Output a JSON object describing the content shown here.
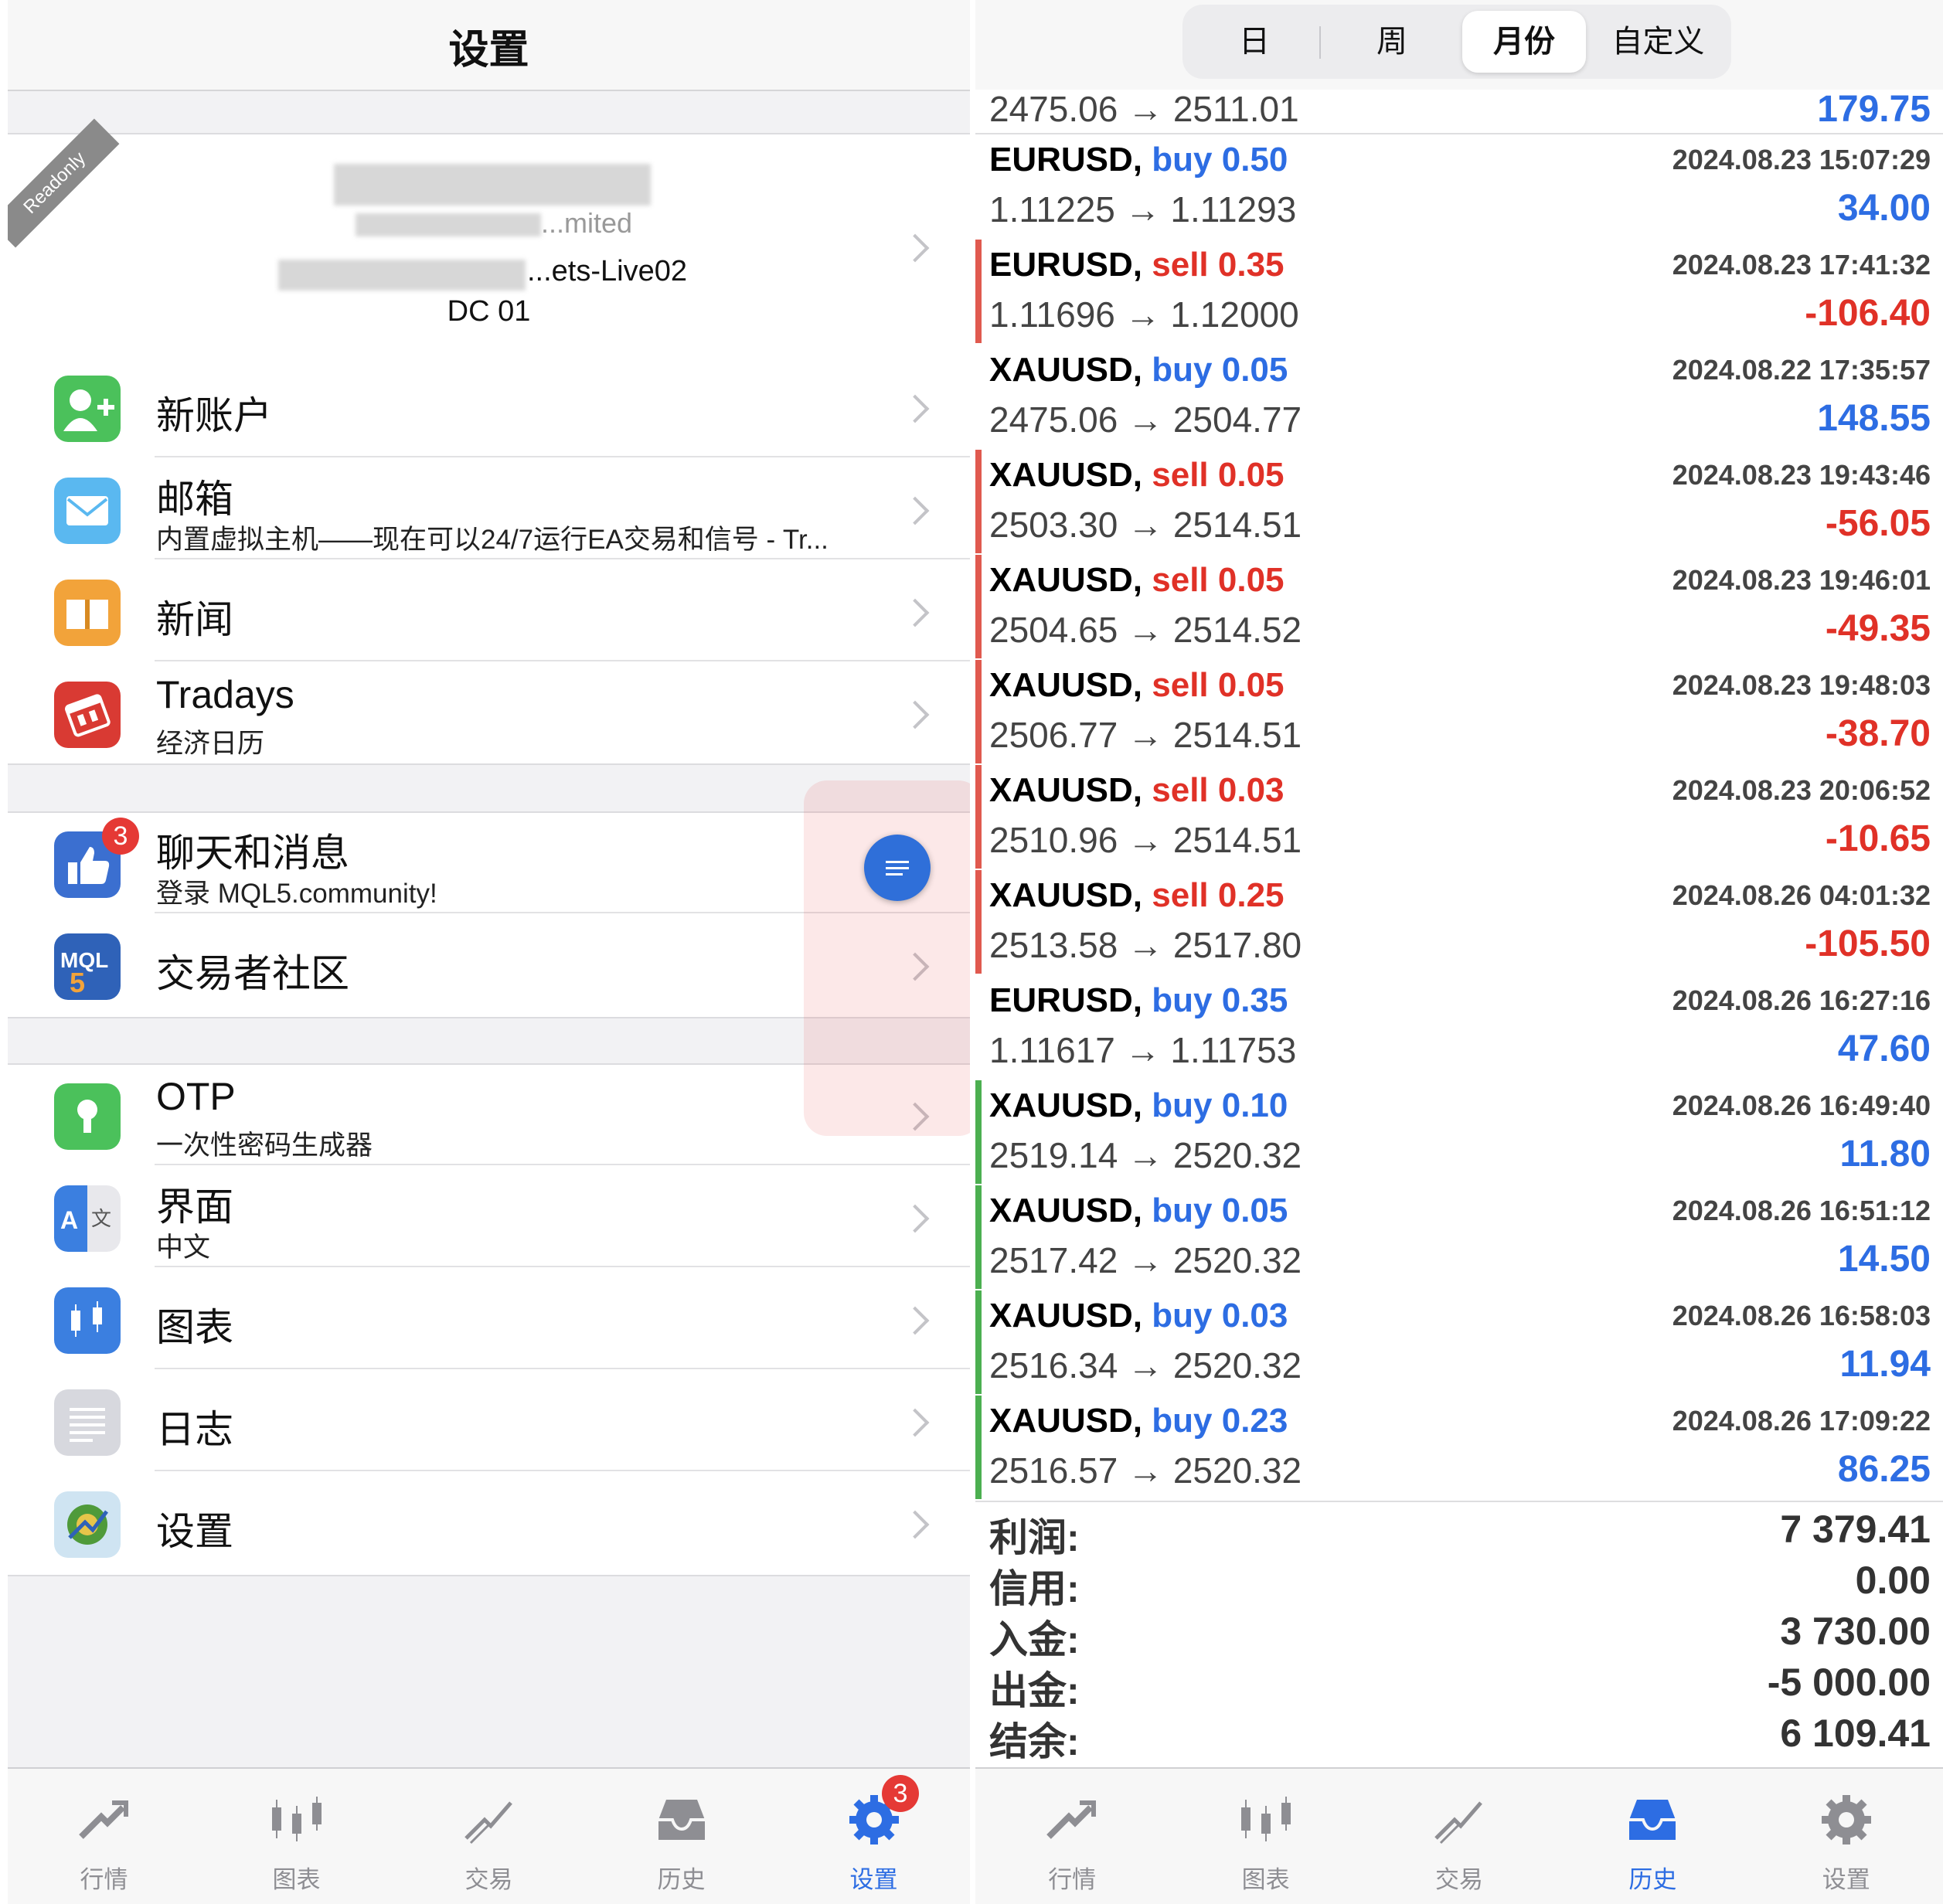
{
  "left": {
    "title": "设置",
    "account": {
      "readonly": "Readonly",
      "name_line": "...mited",
      "server": "...ets-Live02",
      "dc": "DC 01"
    },
    "items": [
      {
        "label": "新账户",
        "sub": "",
        "icon": "add-user-icon"
      },
      {
        "label": "邮箱",
        "sub": "内置虚拟主机——现在可以24/7运行EA交易和信号 - Tr...",
        "icon": "mail-icon"
      },
      {
        "label": "新闻",
        "sub": "",
        "icon": "book-icon"
      },
      {
        "label": "Tradays",
        "sub": "经济日历",
        "icon": "calendar-icon"
      },
      {
        "label": "聊天和消息",
        "sub": "登录 MQL5.community!",
        "icon": "chat-thumb-icon",
        "badge": "3"
      },
      {
        "label": "交易者社区",
        "sub": "",
        "icon": "mql5-icon"
      },
      {
        "label": "OTP",
        "sub": "一次性密码生成器",
        "icon": "lock-icon"
      },
      {
        "label": "界面",
        "sub": "中文",
        "icon": "translate-icon"
      },
      {
        "label": "图表",
        "sub": "",
        "icon": "candles-icon"
      },
      {
        "label": "日志",
        "sub": "",
        "icon": "journal-icon"
      },
      {
        "label": "设置",
        "sub": "",
        "icon": "metatrader-icon"
      }
    ],
    "tabs": [
      {
        "label": "行情",
        "icon": "quotes-icon"
      },
      {
        "label": "图表",
        "icon": "chart-icon"
      },
      {
        "label": "交易",
        "icon": "trade-icon"
      },
      {
        "label": "历史",
        "icon": "history-icon"
      },
      {
        "label": "设置",
        "icon": "settings-icon",
        "badge": "3"
      }
    ],
    "active_tab": 4
  },
  "right": {
    "segments": [
      "日",
      "周",
      "月份",
      "自定义"
    ],
    "active_segment": 2,
    "partial_row": {
      "price": "2475.06 → 2511.01",
      "profit": "179.75"
    },
    "trades": [
      {
        "symbol": "EURUSD,",
        "side": "buy",
        "vol": "0.50",
        "time": "2024.08.23 15:07:29",
        "price": "1.11225 → 1.11293",
        "profit": "34.00",
        "bar": ""
      },
      {
        "symbol": "EURUSD,",
        "side": "sell",
        "vol": "0.35",
        "time": "2024.08.23 17:41:32",
        "price": "1.11696 → 1.12000",
        "profit": "-106.40",
        "bar": "red"
      },
      {
        "symbol": "XAUUSD,",
        "side": "buy",
        "vol": "0.05",
        "time": "2024.08.22 17:35:57",
        "price": "2475.06 → 2504.77",
        "profit": "148.55",
        "bar": ""
      },
      {
        "symbol": "XAUUSD,",
        "side": "sell",
        "vol": "0.05",
        "time": "2024.08.23 19:43:46",
        "price": "2503.30 → 2514.51",
        "profit": "-56.05",
        "bar": "red"
      },
      {
        "symbol": "XAUUSD,",
        "side": "sell",
        "vol": "0.05",
        "time": "2024.08.23 19:46:01",
        "price": "2504.65 → 2514.52",
        "profit": "-49.35",
        "bar": "red"
      },
      {
        "symbol": "XAUUSD,",
        "side": "sell",
        "vol": "0.05",
        "time": "2024.08.23 19:48:03",
        "price": "2506.77 → 2514.51",
        "profit": "-38.70",
        "bar": "red"
      },
      {
        "symbol": "XAUUSD,",
        "side": "sell",
        "vol": "0.03",
        "time": "2024.08.23 20:06:52",
        "price": "2510.96 → 2514.51",
        "profit": "-10.65",
        "bar": "red"
      },
      {
        "symbol": "XAUUSD,",
        "side": "sell",
        "vol": "0.25",
        "time": "2024.08.26 04:01:32",
        "price": "2513.58 → 2517.80",
        "profit": "-105.50",
        "bar": "red"
      },
      {
        "symbol": "EURUSD,",
        "side": "buy",
        "vol": "0.35",
        "time": "2024.08.26 16:27:16",
        "price": "1.11617 → 1.11753",
        "profit": "47.60",
        "bar": ""
      },
      {
        "symbol": "XAUUSD,",
        "side": "buy",
        "vol": "0.10",
        "time": "2024.08.26 16:49:40",
        "price": "2519.14 → 2520.32",
        "profit": "11.80",
        "bar": "green"
      },
      {
        "symbol": "XAUUSD,",
        "side": "buy",
        "vol": "0.05",
        "time": "2024.08.26 16:51:12",
        "price": "2517.42 → 2520.32",
        "profit": "14.50",
        "bar": "green"
      },
      {
        "symbol": "XAUUSD,",
        "side": "buy",
        "vol": "0.03",
        "time": "2024.08.26 16:58:03",
        "price": "2516.34 → 2520.32",
        "profit": "11.94",
        "bar": "green"
      },
      {
        "symbol": "XAUUSD,",
        "side": "buy",
        "vol": "0.23",
        "time": "2024.08.26 17:09:22",
        "price": "2516.57 → 2520.32",
        "profit": "86.25",
        "bar": "green"
      }
    ],
    "summary": [
      {
        "key": "利润:",
        "value": "7 379.41"
      },
      {
        "key": "信用:",
        "value": "0.00"
      },
      {
        "key": "入金:",
        "value": "3 730.00"
      },
      {
        "key": "出金:",
        "value": "-5 000.00"
      },
      {
        "key": "结余:",
        "value": "6 109.41"
      }
    ],
    "tabs": [
      {
        "label": "行情",
        "icon": "quotes-icon"
      },
      {
        "label": "图表",
        "icon": "chart-icon"
      },
      {
        "label": "交易",
        "icon": "trade-icon"
      },
      {
        "label": "历史",
        "icon": "history-icon"
      },
      {
        "label": "设置",
        "icon": "settings-icon"
      }
    ],
    "active_tab": 3
  },
  "colors": {
    "accent": "#2d6de3",
    "sell": "#e03127",
    "green_bar": "#4caf50",
    "red_bar": "#e05a4f"
  }
}
